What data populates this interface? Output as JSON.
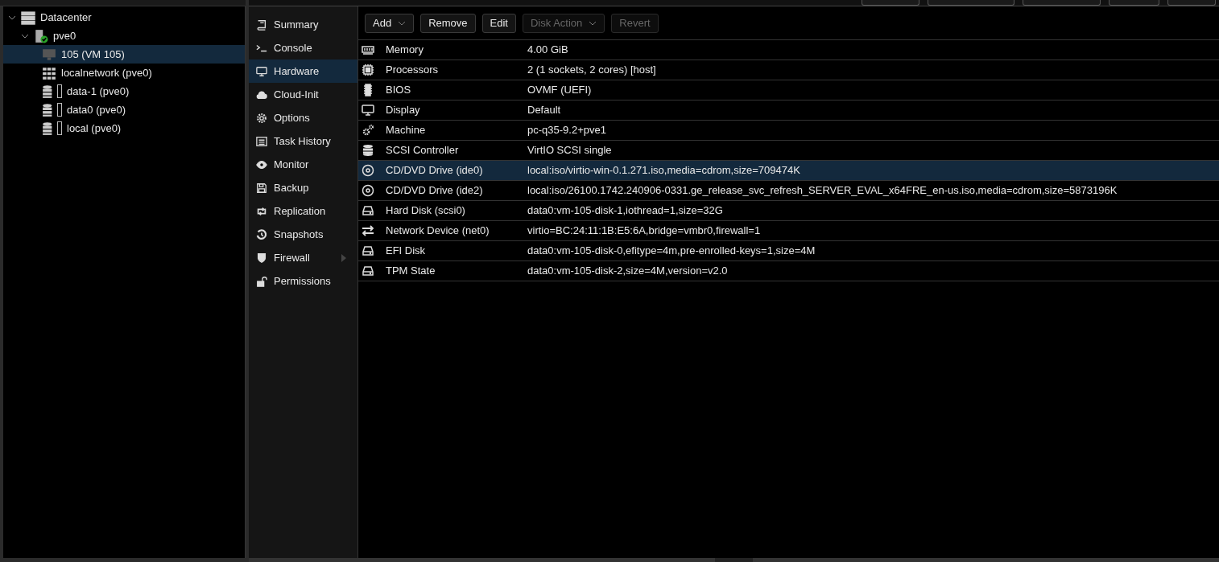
{
  "tree": [
    {
      "label": "Datacenter",
      "kind": "datacenter",
      "expanded": true,
      "selected": false,
      "children": [
        {
          "label": "pve0",
          "kind": "node",
          "expanded": true,
          "selected": false,
          "children": [
            {
              "label": "105 (VM 105)",
              "kind": "vm",
              "selected": true
            },
            {
              "label": "localnetwork (pve0)",
              "kind": "sdn",
              "selected": false
            },
            {
              "label": "data-1 (pve0)",
              "kind": "storage",
              "selected": false
            },
            {
              "label": "data0 (pve0)",
              "kind": "storage",
              "selected": false
            },
            {
              "label": "local (pve0)",
              "kind": "storage",
              "selected": false
            }
          ]
        }
      ]
    }
  ],
  "menu": [
    {
      "label": "Summary",
      "kind": "book",
      "selected": false,
      "submenu": false
    },
    {
      "label": "Console",
      "kind": "terminal",
      "selected": false,
      "submenu": false
    },
    {
      "label": "Hardware",
      "kind": "monitor",
      "selected": true,
      "submenu": false
    },
    {
      "label": "Cloud-Init",
      "kind": "cloud",
      "selected": false,
      "submenu": false
    },
    {
      "label": "Options",
      "kind": "gear",
      "selected": false,
      "submenu": false
    },
    {
      "label": "Task History",
      "kind": "list",
      "selected": false,
      "submenu": false
    },
    {
      "label": "Monitor",
      "kind": "eye",
      "selected": false,
      "submenu": false
    },
    {
      "label": "Backup",
      "kind": "floppy",
      "selected": false,
      "submenu": false
    },
    {
      "label": "Replication",
      "kind": "retweet",
      "selected": false,
      "submenu": false
    },
    {
      "label": "Snapshots",
      "kind": "history",
      "selected": false,
      "submenu": false
    },
    {
      "label": "Firewall",
      "kind": "shield",
      "selected": false,
      "submenu": true
    },
    {
      "label": "Permissions",
      "kind": "unlock",
      "selected": false,
      "submenu": false
    }
  ],
  "toolbar": [
    {
      "label": "Add",
      "disabled": false,
      "dropdown": true
    },
    {
      "label": "Remove",
      "disabled": false,
      "dropdown": false
    },
    {
      "label": "Edit",
      "disabled": false,
      "dropdown": false
    },
    {
      "label": "Disk Action",
      "disabled": true,
      "dropdown": true
    },
    {
      "label": "Revert",
      "disabled": true,
      "dropdown": false
    }
  ],
  "hardware": [
    {
      "kind": "memory",
      "name": "Memory",
      "value": "4.00 GiB",
      "selected": false
    },
    {
      "kind": "cpu",
      "name": "Processors",
      "value": "2 (1 sockets, 2 cores) [host]",
      "selected": false
    },
    {
      "kind": "chip",
      "name": "BIOS",
      "value": "OVMF (UEFI)",
      "selected": false
    },
    {
      "kind": "monitor",
      "name": "Display",
      "value": "Default",
      "selected": false
    },
    {
      "kind": "gears",
      "name": "Machine",
      "value": "pc-q35-9.2+pve1",
      "selected": false
    },
    {
      "kind": "database",
      "name": "SCSI Controller",
      "value": "VirtIO SCSI single",
      "selected": false
    },
    {
      "kind": "disc",
      "name": "CD/DVD Drive (ide0)",
      "value": "local:iso/virtio-win-0.1.271.iso,media=cdrom,size=709474K",
      "selected": true
    },
    {
      "kind": "disc",
      "name": "CD/DVD Drive (ide2)",
      "value": "local:iso/26100.1742.240906-0331.ge_release_svc_refresh_SERVER_EVAL_x64FRE_en-us.iso,media=cdrom,size=5873196K",
      "selected": false
    },
    {
      "kind": "hdd",
      "name": "Hard Disk (scsi0)",
      "value": "data0:vm-105-disk-1,iothread=1,size=32G",
      "selected": false
    },
    {
      "kind": "exchange",
      "name": "Network Device (net0)",
      "value": "virtio=BC:24:11:1B:E5:6A,bridge=vmbr0,firewall=1",
      "selected": false
    },
    {
      "kind": "hdd",
      "name": "EFI Disk",
      "value": "data0:vm-105-disk-0,efitype=4m,pre-enrolled-keys=1,size=4M",
      "selected": false
    },
    {
      "kind": "hdd",
      "name": "TPM State",
      "value": "data0:vm-105-disk-2,size=4M,version=v2.0",
      "selected": false
    }
  ]
}
